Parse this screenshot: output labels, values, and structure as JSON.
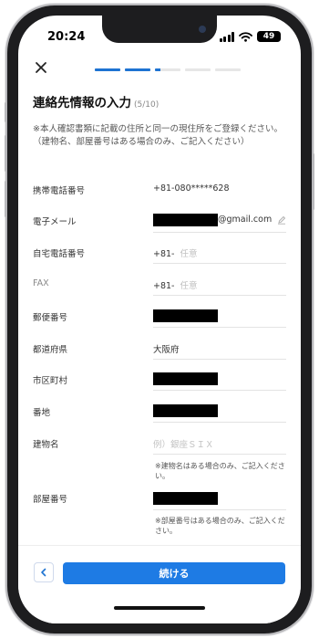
{
  "status_bar": {
    "time": "20:24",
    "battery": "49"
  },
  "progress": {
    "steps_total": 5,
    "current_step_fill": 0.2
  },
  "header": {
    "title": "連絡先情報の入力",
    "step": "(5/10)"
  },
  "note": "※本人確認書類に記載の住所と同一の現住所をご登録ください。（建物名、部屋番号はある場合のみ、ご記入ください）",
  "fields": {
    "mobile": {
      "label": "携帯電話番号",
      "value": "+81-080*****628"
    },
    "email": {
      "label": "電子メール",
      "domain": "@gmail.com"
    },
    "home_phone": {
      "label": "自宅電話番号",
      "prefix": "+81-",
      "placeholder": "任意"
    },
    "fax": {
      "label": "FAX",
      "prefix": "+81-",
      "placeholder": "任意"
    },
    "postal": {
      "label": "郵便番号"
    },
    "prefecture": {
      "label": "都道府県",
      "value": "大阪府"
    },
    "city": {
      "label": "市区町村"
    },
    "street": {
      "label": "番地"
    },
    "building": {
      "label": "建物名",
      "placeholder": "例）銀座ＳＩＸ",
      "hint": "※建物名はある場合のみ、ご記入ください。"
    },
    "room": {
      "label": "部屋番号",
      "hint": "※部屋番号はある場合のみ、ご記入ください。"
    }
  },
  "footer": {
    "continue_label": "続ける"
  },
  "colors": {
    "accent": "#1e7be4",
    "progress_active": "#1e73d2"
  },
  "icons": [
    "close-icon",
    "pencil-icon",
    "chevron-left-icon",
    "wifi-icon",
    "signal-icon",
    "battery-icon"
  ]
}
